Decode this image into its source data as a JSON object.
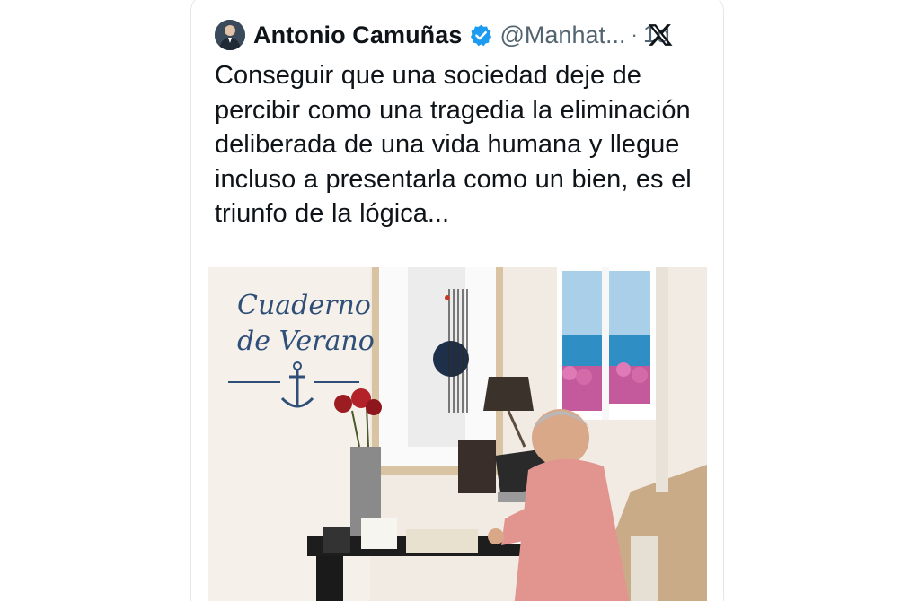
{
  "tweet": {
    "author_name": "Antonio Camuñas",
    "handle": "@Manhat...",
    "separator": "·",
    "time": "1d",
    "verified": true,
    "verified_icon": "verified-badge-icon",
    "brand_icon": "x-logo-icon",
    "text": "Conseguir que una sociedad deje de percibir como una tragedia la eliminación deliberada de una vida humana y llegue incluso a presentarla como un bien, es el triunfo de la lógica..."
  },
  "photo": {
    "title_line1": "Cuaderno",
    "title_line2": "de Verano",
    "emblem_icon": "anchor-icon"
  },
  "colors": {
    "verified_blue": "#1d9bf0",
    "text": "#0f1419",
    "secondary_text": "#536471",
    "title_blue": "#2f4e78"
  }
}
